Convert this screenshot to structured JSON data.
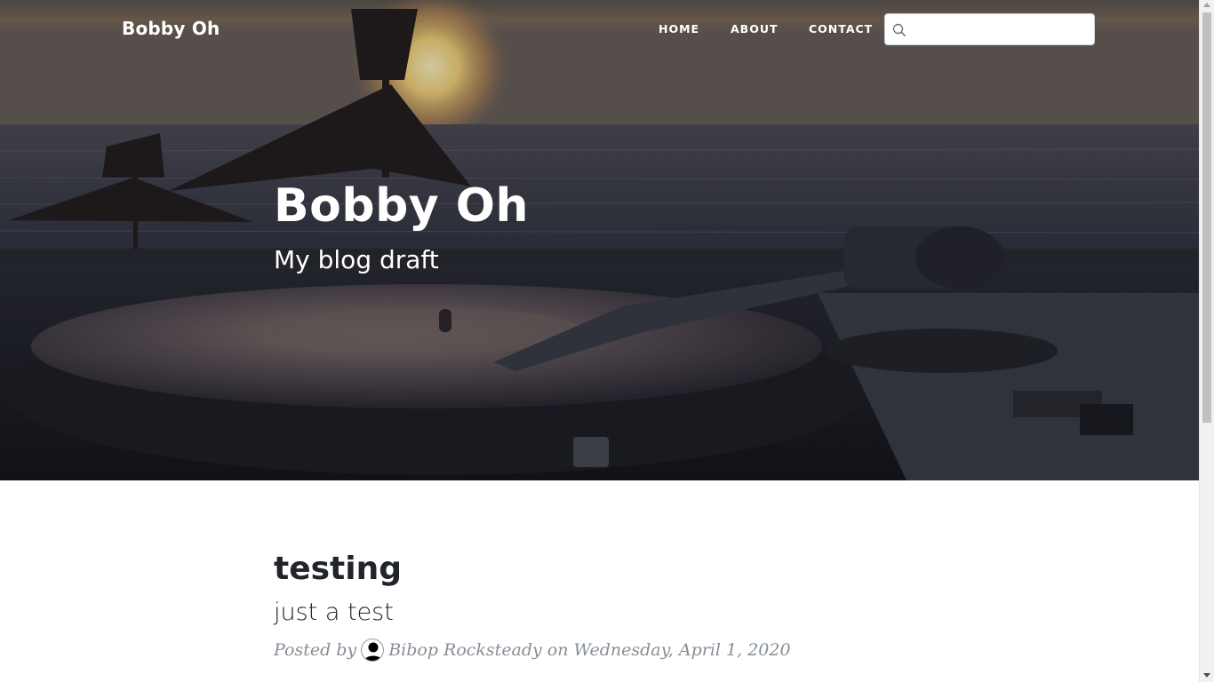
{
  "navbar": {
    "brand": "Bobby Oh",
    "links": [
      "HOME",
      "ABOUT",
      "CONTACT"
    ],
    "search_placeholder": ""
  },
  "hero": {
    "title": "Bobby Oh",
    "subtitle": "My blog draft"
  },
  "post": {
    "title": "testing",
    "subtitle": "just a test",
    "posted_by_prefix": "Posted by",
    "author": "Bibop Rocksteady",
    "date_prefix": "on",
    "date": "Wednesday, April 1, 2020"
  },
  "icons": {
    "search": "search-icon",
    "avatar": "avatar-icon"
  },
  "colors": {
    "heading": "#212529",
    "meta": "#868e96",
    "nav_text": "#ffffff"
  }
}
